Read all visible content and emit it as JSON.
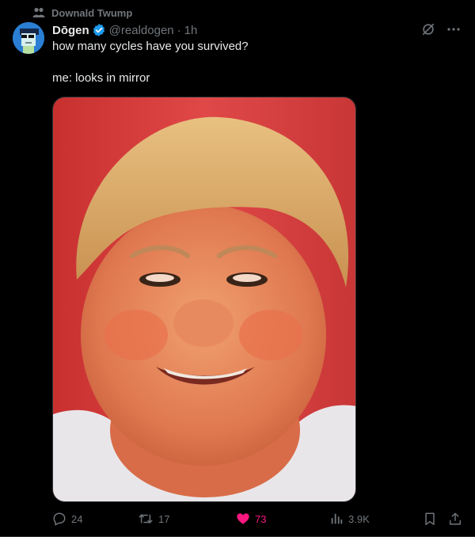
{
  "social_context": {
    "label": "Downald Twump",
    "icon": "people-icon"
  },
  "author": {
    "name": "Dōgen",
    "verified": true,
    "handle": "@realdogen",
    "separator": "·",
    "time": "1h",
    "avatar": "pixel-art-avatar"
  },
  "tweet": {
    "line1": "how many cycles have you survived?",
    "line2": "me: looks in mirror"
  },
  "media": {
    "type": "photo",
    "description_icon": "portrait-photo"
  },
  "actions": {
    "replies": "24",
    "reposts": "17",
    "likes": "73",
    "views": "3.9K"
  },
  "colors": {
    "background": "#000000",
    "text": "#e7e9ea",
    "muted": "#71767b",
    "verified": "#1d9bf0",
    "like": "#f91880"
  }
}
